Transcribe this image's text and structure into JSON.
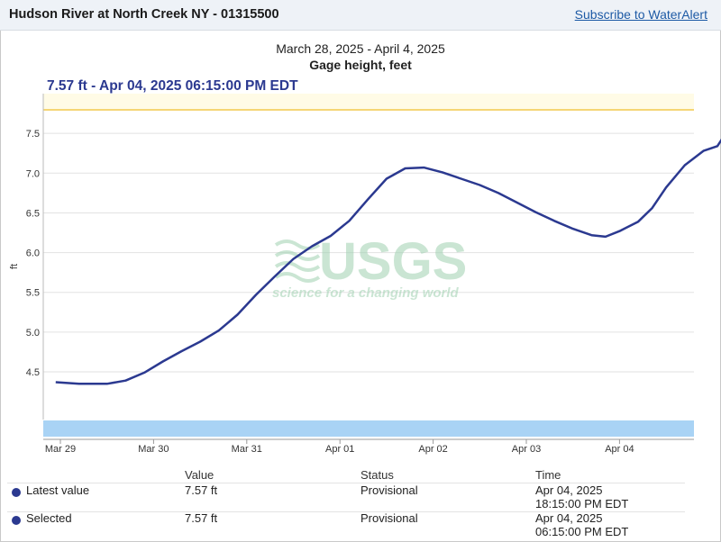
{
  "header": {
    "site_title": "Hudson River at North Creek NY - 01315500",
    "alert_link": "Subscribe to WaterAlert"
  },
  "chart": {
    "date_range": "March 28, 2025 - April 4, 2025",
    "parameter": "Gage height, feet",
    "readout": "7.57 ft - Apr 04, 2025 06:15:00 PM EDT",
    "ylabel": "ft",
    "watermark_logo": "USGS",
    "watermark_tagline": "science for a changing world"
  },
  "chart_data": {
    "type": "line",
    "title": "March 28, 2025 - April 4, 2025",
    "subtitle": "Gage height, feet",
    "ylabel": "ft",
    "ylim": [
      3.9,
      8.0
    ],
    "y_ticks": [
      "4.5",
      "5.0",
      "5.5",
      "6.0",
      "6.5",
      "7.0",
      "7.5"
    ],
    "x_ticks": [
      "Mar 29",
      "Mar 30",
      "Mar 31",
      "Apr 01",
      "Apr 02",
      "Apr 03",
      "Apr 04"
    ],
    "grid": true,
    "threshold_value": 8.0,
    "series": [
      {
        "values_days_from_mar29": [
          [
            -0.05,
            4.37
          ],
          [
            0.2,
            4.35
          ],
          [
            0.5,
            4.35
          ],
          [
            0.7,
            4.39
          ],
          [
            0.9,
            4.49
          ],
          [
            1.1,
            4.63
          ],
          [
            1.3,
            4.76
          ],
          [
            1.5,
            4.88
          ],
          [
            1.7,
            5.02
          ],
          [
            1.9,
            5.22
          ],
          [
            2.1,
            5.47
          ],
          [
            2.3,
            5.7
          ],
          [
            2.5,
            5.92
          ],
          [
            2.7,
            6.08
          ],
          [
            2.9,
            6.21
          ],
          [
            3.1,
            6.4
          ],
          [
            3.3,
            6.67
          ],
          [
            3.5,
            6.93
          ],
          [
            3.7,
            7.06
          ],
          [
            3.9,
            7.07
          ],
          [
            4.1,
            7.01
          ],
          [
            4.3,
            6.93
          ],
          [
            4.5,
            6.85
          ],
          [
            4.7,
            6.75
          ],
          [
            4.9,
            6.63
          ],
          [
            5.1,
            6.51
          ],
          [
            5.3,
            6.4
          ],
          [
            5.5,
            6.3
          ],
          [
            5.7,
            6.22
          ],
          [
            5.85,
            6.2
          ],
          [
            6.0,
            6.27
          ],
          [
            6.2,
            6.39
          ],
          [
            6.35,
            6.56
          ],
          [
            6.5,
            6.82
          ],
          [
            6.7,
            7.1
          ],
          [
            6.9,
            7.28
          ],
          [
            7.05,
            7.34
          ],
          [
            7.15,
            7.52
          ],
          [
            7.3,
            7.57
          ],
          [
            7.4,
            7.57
          ]
        ]
      }
    ],
    "latest_point": 7.57
  },
  "table": {
    "headers": {
      "value": "Value",
      "status": "Status",
      "time": "Time"
    },
    "rows": [
      {
        "label": "Latest value",
        "value": "7.57 ft",
        "status": "Provisional",
        "date": "Apr 04, 2025",
        "time": "18:15:00 PM EDT"
      },
      {
        "label": "Selected",
        "value": "7.57 ft",
        "status": "Provisional",
        "date": "Apr 04, 2025",
        "time": "06:15:00 PM EDT"
      }
    ]
  },
  "colors": {
    "series": "#2b3990",
    "threshold": "#f2c94c",
    "navigator": "#a9d3f5",
    "watermark": "#cfe6d6"
  }
}
